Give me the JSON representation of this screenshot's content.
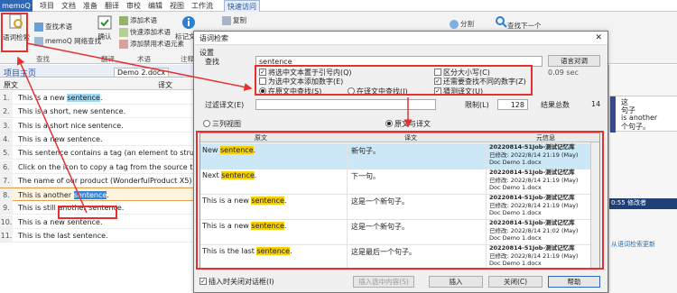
{
  "app": {
    "menu": "memoQ"
  },
  "ribbon_tabs": [
    "项目",
    "文档",
    "准备",
    "翻译",
    "审校",
    "编辑",
    "视图",
    "工作流",
    "快速访问"
  ],
  "ribbon": {
    "concordance": "语词检索",
    "find_term": "查找术语",
    "memoq_web_search": "memoQ 网络查找",
    "confirm": "确认",
    "add_term": "添加术语",
    "quick_add_term": "快速添加术语",
    "add_forbidden_term": "添加禁用术语元素",
    "mark_text": "标记文本",
    "copy": "复制",
    "split": "分割",
    "find_next": "查找下一个",
    "group_find": "查找",
    "group_translate": "翻译",
    "group_terms": "术语",
    "group_notes": "注释"
  },
  "project": {
    "title": "项目主页",
    "doc_tab": "Demo 2.docx",
    "source_col": "原文",
    "target_col": "译文"
  },
  "segments": [
    {
      "n": "1.",
      "pre": "This is a new ",
      "hit": "sentence",
      "post": "."
    },
    {
      "n": "2.",
      "pre": "This is a short, new sentence.",
      "hit": "",
      "post": ""
    },
    {
      "n": "3.",
      "pre": "This is a short nice sentence.",
      "hit": "",
      "post": ""
    },
    {
      "n": "4.",
      "pre": "This is a new sentence.",
      "hit": "",
      "post": ""
    },
    {
      "n": "5.",
      "pre": "This sentence contains a tag ",
      "hit": "",
      "post": "(an element to structu"
    },
    {
      "n": "6.",
      "pre": "Click on the ",
      "hit": "",
      "post": " icon to copy a tag from the source t segment."
    },
    {
      "n": "7.",
      "pre": "The name of our product (WonderfulProduct X5) should",
      "hit": "",
      "post": ""
    },
    {
      "n": "8.",
      "pre": "This is another ",
      "hit": "sentence",
      "post": "."
    },
    {
      "n": "9.",
      "pre": "This is still another sentence.",
      "hit": "",
      "post": ""
    },
    {
      "n": "10.",
      "pre": "This is a new sentence.",
      "hit": "",
      "post": ""
    },
    {
      "n": "11.",
      "pre": "This is the last sentence.",
      "hit": "",
      "post": ""
    }
  ],
  "dialog": {
    "title": "语词检索",
    "settings": "设置",
    "search_label": "查找",
    "search_value": "sentence",
    "language_btn": "语言对调",
    "opt_quotes": "将选中文本置于引号内(Q)",
    "opt_numbers": "为选中文本添加数字(E)",
    "opt_in_source": "在原文中查找(S)",
    "opt_in_target": "在译文中查找(I)",
    "opt_case": "区分大小写(C)",
    "opt_diff_numbers": "还需要查找不同的数字(Z)",
    "opt_guess": "猜测译文(U)",
    "time": "0.09 sec",
    "filter_target": "过滤译文(E)",
    "limit_label": "限制(L)",
    "limit_value": "128",
    "total_label": "结果总数",
    "total_value": "14",
    "view_three": "三列视图",
    "view_original": "原文与译文",
    "col_source": "原文",
    "col_target": "译文",
    "col_meta": "元信息",
    "results": [
      {
        "src_pre": "New ",
        "src_hit": "sentence",
        "src_post": ".",
        "tgt": "新句子。",
        "tm": "20220814-51Job-测试记忆库",
        "meta1": "已修改: 2022/8/14 21:19 (May)",
        "doc": "Doc  Demo 1.docx"
      },
      {
        "src_pre": "Next ",
        "src_hit": "sentence",
        "src_post": ".",
        "tgt": "下一句。",
        "tm": "20220814-51Job-测试记忆库",
        "meta1": "已修改: 2022/8/14 21:19 (May)",
        "doc": "Doc  Demo 1.docx"
      },
      {
        "src_pre": "This is a new ",
        "src_hit": "sentence",
        "src_post": ".",
        "tgt": "这是一个新句子。",
        "tm": "20220814-51Job-测试记忆库",
        "meta1": "已修改: 2022/8/14 21:19 (May)",
        "doc": "Doc  Demo 1.docx"
      },
      {
        "src_pre": "This is a new ",
        "src_hit": "sentence",
        "src_post": ".",
        "tgt": "这是一个新句子。",
        "tm": "20220814-51Job-测试记忆库",
        "meta1": "已修改: 2022/8/14 21:02 (May)",
        "doc": "Doc  Demo 1.docx"
      },
      {
        "src_pre": "This is the last ",
        "src_hit": "sentence",
        "src_post": ".",
        "tgt": "这是最后一个句子。",
        "tm": "20220814-51Job-测试记忆库",
        "meta1": "已修改: 2022/8/14 21:19 (May)",
        "doc": "Doc  Demo 1.docx"
      }
    ],
    "insert_on_close": "插入时关闭对话框(I)",
    "insert_selection": "插入选中内容(S)",
    "insert": "插入",
    "close": "关闭(C)",
    "help": "帮助"
  },
  "right_pane": {
    "r1": "这",
    "r2": "句子",
    "r3": "is another",
    "r4": "个句子。",
    "time": "0:55",
    "status": "修改者",
    "update": "从语词检索更新"
  },
  "colors": {
    "accent": "#2f66b6",
    "highlight": "#f6d000",
    "annotation": "#e53030"
  }
}
